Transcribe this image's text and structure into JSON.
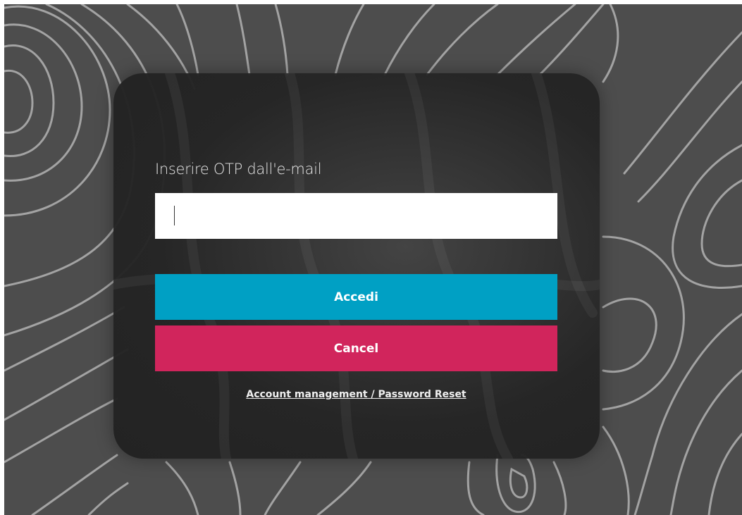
{
  "login": {
    "otp_label": "Inserire OTP dall'e-mail",
    "otp_value": "",
    "otp_placeholder": "",
    "submit_label": "Accedi",
    "cancel_label": "Cancel",
    "account_link": "Account management / Password Reset"
  },
  "colors": {
    "background": "#4d4d4d",
    "contour_lines": "#9a9a9a",
    "card": "#242424",
    "submit_button": "#00a0c4",
    "cancel_button": "#d1255c"
  }
}
